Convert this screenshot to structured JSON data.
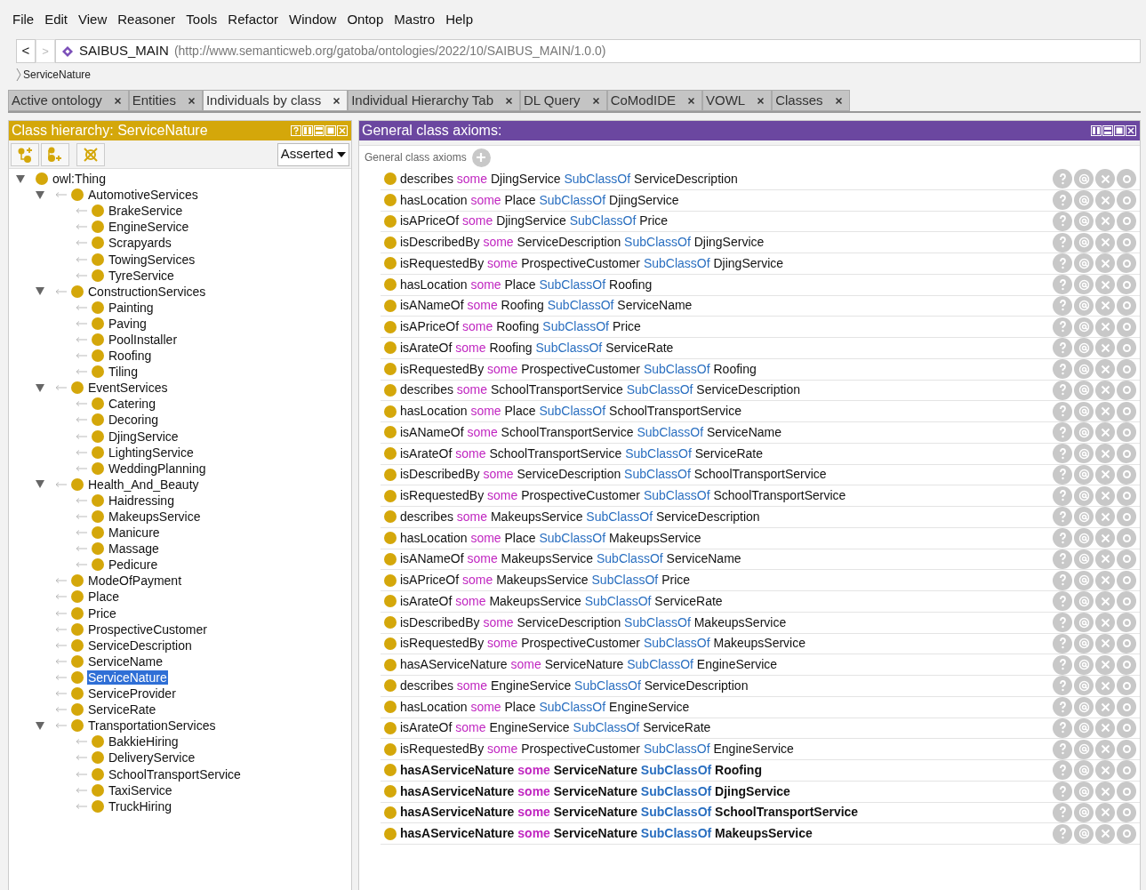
{
  "menu": [
    "File",
    "Edit",
    "View",
    "Reasoner",
    "Tools",
    "Refactor",
    "Window",
    "Ontop",
    "Mastro",
    "Help"
  ],
  "nav": {
    "back": "<",
    "forward": ">",
    "ontology": "SAIBUS_MAIN",
    "iri": "(http://www.semanticweb.org/gatoba/ontologies/2022/10/SAIBUS_MAIN/1.0.0)",
    "breadcrumb": "ServiceNature"
  },
  "tabs": [
    {
      "label": "Active ontology",
      "selected": false
    },
    {
      "label": "Entities",
      "selected": false
    },
    {
      "label": "Individuals by class",
      "selected": true
    },
    {
      "label": "Individual Hierarchy Tab",
      "selected": false
    },
    {
      "label": "DL Query",
      "selected": false
    },
    {
      "label": "CoModIDE",
      "selected": false
    },
    {
      "label": "VOWL",
      "selected": false
    },
    {
      "label": "Classes",
      "selected": false
    }
  ],
  "class_hierarchy": {
    "title": "Class hierarchy: ServiceNature",
    "mode": "Asserted",
    "tree": [
      {
        "label": "owl:Thing",
        "selected": false,
        "expanded": true,
        "children": [
          {
            "label": "AutomotiveServices",
            "selected": false,
            "expanded": true,
            "children": [
              {
                "label": "BrakeService",
                "selected": false
              },
              {
                "label": "EngineService",
                "selected": false
              },
              {
                "label": "Scrapyards",
                "selected": false
              },
              {
                "label": "TowingServices",
                "selected": false
              },
              {
                "label": "TyreService",
                "selected": false
              }
            ]
          },
          {
            "label": "ConstructionServices",
            "selected": false,
            "expanded": true,
            "children": [
              {
                "label": "Painting",
                "selected": false
              },
              {
                "label": "Paving",
                "selected": false
              },
              {
                "label": "PoolInstaller",
                "selected": false
              },
              {
                "label": "Roofing",
                "selected": false
              },
              {
                "label": "Tiling",
                "selected": false
              }
            ]
          },
          {
            "label": "EventServices",
            "selected": false,
            "expanded": true,
            "children": [
              {
                "label": "Catering",
                "selected": false
              },
              {
                "label": "Decoring",
                "selected": false
              },
              {
                "label": "DjingService",
                "selected": false
              },
              {
                "label": "LightingService",
                "selected": false
              },
              {
                "label": "WeddingPlanning",
                "selected": false
              }
            ]
          },
          {
            "label": "Health_And_Beauty",
            "selected": false,
            "expanded": true,
            "children": [
              {
                "label": "Haidressing",
                "selected": false
              },
              {
                "label": "MakeupsService",
                "selected": false
              },
              {
                "label": "Manicure",
                "selected": false
              },
              {
                "label": "Massage",
                "selected": false
              },
              {
                "label": "Pedicure",
                "selected": false
              }
            ]
          },
          {
            "label": "ModeOfPayment",
            "selected": false
          },
          {
            "label": "Place",
            "selected": false
          },
          {
            "label": "Price",
            "selected": false
          },
          {
            "label": "ProspectiveCustomer",
            "selected": false
          },
          {
            "label": "ServiceDescription",
            "selected": false
          },
          {
            "label": "ServiceName",
            "selected": false
          },
          {
            "label": "ServiceNature",
            "selected": true
          },
          {
            "label": "ServiceProvider",
            "selected": false
          },
          {
            "label": "ServiceRate",
            "selected": false
          },
          {
            "label": "TransportationServices",
            "selected": false,
            "expanded": true,
            "children": [
              {
                "label": "BakkieHiring",
                "selected": false
              },
              {
                "label": "DeliveryService",
                "selected": false
              },
              {
                "label": "SchoolTransportService",
                "selected": false
              },
              {
                "label": "TaxiService",
                "selected": false
              },
              {
                "label": "TruckHiring",
                "selected": false
              }
            ]
          }
        ]
      }
    ]
  },
  "axioms_panel": {
    "title": "General class axioms:",
    "section": "General class axioms",
    "axioms": [
      {
        "property": "describes",
        "quantifier": "some",
        "filler": "DjingService",
        "relation": "SubClassOf",
        "superclass": "ServiceDescription",
        "bold": false
      },
      {
        "property": "hasLocation",
        "quantifier": "some",
        "filler": "Place",
        "relation": "SubClassOf",
        "superclass": "DjingService",
        "bold": false
      },
      {
        "property": "isAPriceOf",
        "quantifier": "some",
        "filler": "DjingService",
        "relation": "SubClassOf",
        "superclass": "Price",
        "bold": false
      },
      {
        "property": "isDescribedBy",
        "quantifier": "some",
        "filler": "ServiceDescription",
        "relation": "SubClassOf",
        "superclass": "DjingService",
        "bold": false
      },
      {
        "property": "isRequestedBy",
        "quantifier": "some",
        "filler": "ProspectiveCustomer",
        "relation": "SubClassOf",
        "superclass": "DjingService",
        "bold": false
      },
      {
        "property": "hasLocation",
        "quantifier": "some",
        "filler": "Place",
        "relation": "SubClassOf",
        "superclass": "Roofing",
        "bold": false
      },
      {
        "property": "isANameOf",
        "quantifier": "some",
        "filler": "Roofing",
        "relation": "SubClassOf",
        "superclass": "ServiceName",
        "bold": false
      },
      {
        "property": "isAPriceOf",
        "quantifier": "some",
        "filler": "Roofing",
        "relation": "SubClassOf",
        "superclass": "Price",
        "bold": false
      },
      {
        "property": "isArateOf",
        "quantifier": "some",
        "filler": "Roofing",
        "relation": "SubClassOf",
        "superclass": "ServiceRate",
        "bold": false
      },
      {
        "property": "isRequestedBy",
        "quantifier": "some",
        "filler": "ProspectiveCustomer",
        "relation": "SubClassOf",
        "superclass": "Roofing",
        "bold": false
      },
      {
        "property": "describes",
        "quantifier": "some",
        "filler": "SchoolTransportService",
        "relation": "SubClassOf",
        "superclass": "ServiceDescription",
        "bold": false
      },
      {
        "property": "hasLocation",
        "quantifier": "some",
        "filler": "Place",
        "relation": "SubClassOf",
        "superclass": "SchoolTransportService",
        "bold": false
      },
      {
        "property": "isANameOf",
        "quantifier": "some",
        "filler": "SchoolTransportService",
        "relation": "SubClassOf",
        "superclass": "ServiceName",
        "bold": false
      },
      {
        "property": "isArateOf",
        "quantifier": "some",
        "filler": "SchoolTransportService",
        "relation": "SubClassOf",
        "superclass": "ServiceRate",
        "bold": false
      },
      {
        "property": "isDescribedBy",
        "quantifier": "some",
        "filler": "ServiceDescription",
        "relation": "SubClassOf",
        "superclass": "SchoolTransportService",
        "bold": false
      },
      {
        "property": "isRequestedBy",
        "quantifier": "some",
        "filler": "ProspectiveCustomer",
        "relation": "SubClassOf",
        "superclass": "SchoolTransportService",
        "bold": false
      },
      {
        "property": "describes",
        "quantifier": "some",
        "filler": "MakeupsService",
        "relation": "SubClassOf",
        "superclass": "ServiceDescription",
        "bold": false
      },
      {
        "property": "hasLocation",
        "quantifier": "some",
        "filler": "Place",
        "relation": "SubClassOf",
        "superclass": "MakeupsService",
        "bold": false
      },
      {
        "property": "isANameOf",
        "quantifier": "some",
        "filler": "MakeupsService",
        "relation": "SubClassOf",
        "superclass": "ServiceName",
        "bold": false
      },
      {
        "property": "isAPriceOf",
        "quantifier": "some",
        "filler": "MakeupsService",
        "relation": "SubClassOf",
        "superclass": "Price",
        "bold": false
      },
      {
        "property": "isArateOf",
        "quantifier": "some",
        "filler": "MakeupsService",
        "relation": "SubClassOf",
        "superclass": "ServiceRate",
        "bold": false
      },
      {
        "property": "isDescribedBy",
        "quantifier": "some",
        "filler": "ServiceDescription",
        "relation": "SubClassOf",
        "superclass": "MakeupsService",
        "bold": false
      },
      {
        "property": "isRequestedBy",
        "quantifier": "some",
        "filler": "ProspectiveCustomer",
        "relation": "SubClassOf",
        "superclass": "MakeupsService",
        "bold": false
      },
      {
        "property": "hasAServiceNature",
        "quantifier": "some",
        "filler": "ServiceNature",
        "relation": "SubClassOf",
        "superclass": "EngineService",
        "bold": false
      },
      {
        "property": "describes",
        "quantifier": "some",
        "filler": "EngineService",
        "relation": "SubClassOf",
        "superclass": "ServiceDescription",
        "bold": false
      },
      {
        "property": "hasLocation",
        "quantifier": "some",
        "filler": "Place",
        "relation": "SubClassOf",
        "superclass": "EngineService",
        "bold": false
      },
      {
        "property": "isArateOf",
        "quantifier": "some",
        "filler": "EngineService",
        "relation": "SubClassOf",
        "superclass": "ServiceRate",
        "bold": false
      },
      {
        "property": "isRequestedBy",
        "quantifier": "some",
        "filler": "ProspectiveCustomer",
        "relation": "SubClassOf",
        "superclass": "EngineService",
        "bold": false
      },
      {
        "property": "hasAServiceNature",
        "quantifier": "some",
        "filler": "ServiceNature",
        "relation": "SubClassOf",
        "superclass": "Roofing",
        "bold": true
      },
      {
        "property": "hasAServiceNature",
        "quantifier": "some",
        "filler": "ServiceNature",
        "relation": "SubClassOf",
        "superclass": "DjingService",
        "bold": true
      },
      {
        "property": "hasAServiceNature",
        "quantifier": "some",
        "filler": "ServiceNature",
        "relation": "SubClassOf",
        "superclass": "SchoolTransportService",
        "bold": true
      },
      {
        "property": "hasAServiceNature",
        "quantifier": "some",
        "filler": "ServiceNature",
        "relation": "SubClassOf",
        "superclass": "MakeupsService",
        "bold": true
      }
    ]
  }
}
